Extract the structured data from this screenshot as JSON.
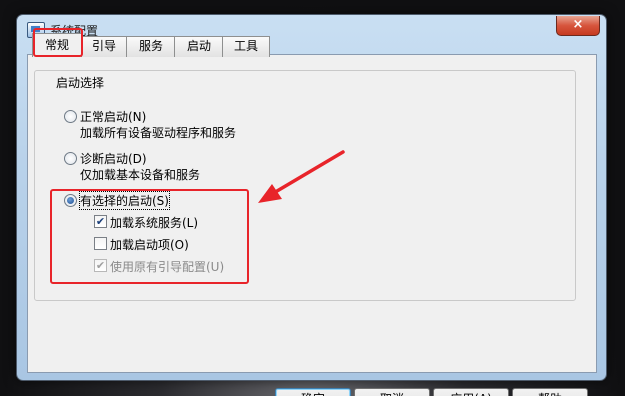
{
  "window": {
    "title": "系统配置",
    "close_glyph": "×",
    "accent_red": "#e8242a"
  },
  "tabs": [
    {
      "label": "常规",
      "active": true
    },
    {
      "label": "引导",
      "active": false
    },
    {
      "label": "服务",
      "active": false
    },
    {
      "label": "启动",
      "active": false
    },
    {
      "label": "工具",
      "active": false
    }
  ],
  "startup_group": {
    "legend": "启动选择",
    "normal": {
      "label": "正常启动(N)",
      "desc": "加载所有设备驱动程序和服务",
      "selected": false
    },
    "diagnostic": {
      "label": "诊断启动(D)",
      "desc": "仅加载基本设备和服务",
      "selected": false
    },
    "selective": {
      "label": "有选择的启动(S)",
      "selected": true,
      "options": [
        {
          "label": "加载系统服务(L)",
          "checked": true,
          "enabled": true
        },
        {
          "label": "加载启动项(O)",
          "checked": false,
          "enabled": true
        },
        {
          "label": "使用原有引导配置(U)",
          "checked": true,
          "enabled": false
        }
      ]
    }
  },
  "buttons": {
    "ok": "确定",
    "cancel": "取消",
    "apply": "应用(A)",
    "help": "帮助"
  },
  "icons": {
    "check_glyph": "✔"
  }
}
